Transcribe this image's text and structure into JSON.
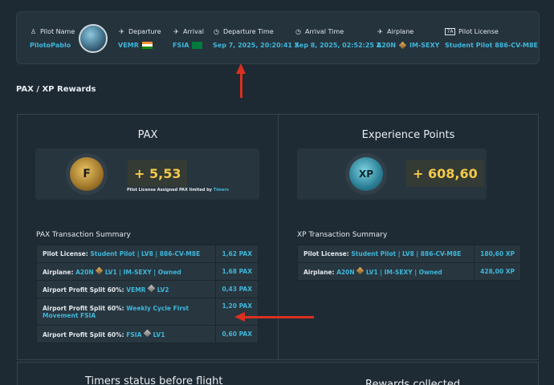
{
  "header": {
    "pilot_name": {
      "label": "Pilot Name",
      "value": "PilotoPablo",
      "icon": "pilot-icon"
    },
    "departure": {
      "label": "Departure",
      "value": "VEMR",
      "icon": "takeoff-icon",
      "flag": "india-flag"
    },
    "arrival": {
      "label": "Arrival",
      "value": "FSIA",
      "icon": "landing-icon",
      "flag": "seychelles-flag"
    },
    "departure_time": {
      "label": "Departure Time",
      "value": "Sep 7, 2025, 20:20:41 Z",
      "icon": "clock-icon"
    },
    "arrival_time": {
      "label": "Arrival Time",
      "value": "Sep 8, 2025, 02:52:25 Z",
      "icon": "clock-icon"
    },
    "airplane": {
      "label": "Airplane",
      "model": "A20N",
      "registration": "IM-SEXY",
      "icon": "airplane-icon"
    },
    "pilot_license": {
      "label": "Pilot License",
      "value": "Student Pilot  886-CV-M8E",
      "icon": "license-icon"
    }
  },
  "section_title": "PAX / XP Rewards",
  "pax": {
    "title": "PAX",
    "amount": "+ 5,53",
    "note_prefix": "Pilot License Assigned PAX limited by",
    "note_link": "Timers",
    "summary_title": "PAX Transaction Summary",
    "rows": [
      {
        "label": "Pilot License:",
        "detail": "Student Pilot | LV8 | 886-CV-M8E",
        "detail2": "",
        "amount": "1,62 PAX"
      },
      {
        "label": "Airplane:",
        "detail": "A20N",
        "detail2": "LV1 | IM-SEXY | Owned",
        "amount": "1,68 PAX"
      },
      {
        "label": "Airport Profit Split 60%:",
        "detail": "VEMR",
        "detail2": "LV2",
        "amount": "0,43 PAX"
      },
      {
        "label": "Airport Profit Split 60%:",
        "detail": "Weekly Cycle First Movement FSIA",
        "detail2": "",
        "amount": "1,20 PAX"
      },
      {
        "label": "Airport Profit Split 60%:",
        "detail": "FSIA",
        "detail2": "LV1",
        "amount": "0,60 PAX"
      }
    ]
  },
  "xp": {
    "title": "Experience Points",
    "amount": "+ 608,60",
    "summary_title": "XP Transaction Summary",
    "rows": [
      {
        "label": "Pilot License:",
        "detail": "Student Pilot | LV8 | 886-CV-M8E",
        "detail2": "",
        "amount": "180,60 XP"
      },
      {
        "label": "Airplane:",
        "detail": "A20N",
        "detail2": "LV1 | IM-SEXY | Owned",
        "amount": "428,00 XP"
      }
    ]
  },
  "bottom": {
    "timers_title": "Timers status before flight",
    "rewards_title": "Rewards collected"
  },
  "colors": {
    "accent": "#3fb6d9",
    "gold": "#f2c94c",
    "arrow": "#d9301f"
  }
}
